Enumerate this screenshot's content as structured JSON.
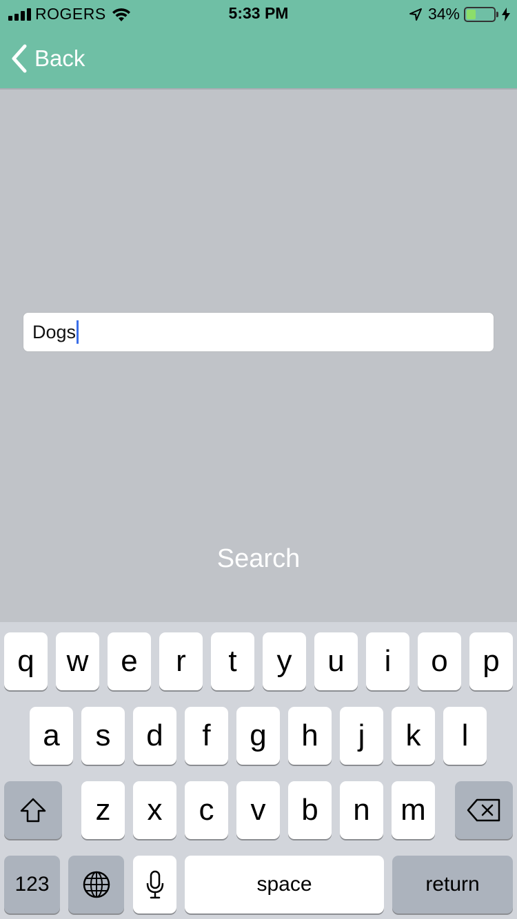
{
  "status_bar": {
    "carrier": "ROGERS",
    "time": "5:33 PM",
    "battery_percent_label": "34%",
    "battery_level": 0.34,
    "icons": [
      "signal-bars-icon",
      "wifi-icon",
      "location-arrow-icon",
      "battery-icon",
      "charging-bolt-icon"
    ]
  },
  "nav": {
    "back_label": "Back",
    "back_icon": "chevron-left-icon"
  },
  "search": {
    "value": "Dogs",
    "button_label": "Search"
  },
  "keyboard": {
    "row1": [
      "q",
      "w",
      "e",
      "r",
      "t",
      "y",
      "u",
      "i",
      "o",
      "p"
    ],
    "row2": [
      "a",
      "s",
      "d",
      "f",
      "g",
      "h",
      "j",
      "k",
      "l"
    ],
    "row3": [
      "z",
      "x",
      "c",
      "v",
      "b",
      "n",
      "m"
    ],
    "shift_icon": "shift-arrow-icon",
    "delete_icon": "backspace-icon",
    "numbers_label": "123",
    "globe_icon": "globe-icon",
    "mic_icon": "microphone-icon",
    "space_label": "space",
    "return_label": "return"
  },
  "colors": {
    "header": "#6fbfa5",
    "background": "#c0c3c8",
    "keyboard": "#d2d5db",
    "caret": "#3a6ee8",
    "battery_fill": "#8cde6a"
  }
}
